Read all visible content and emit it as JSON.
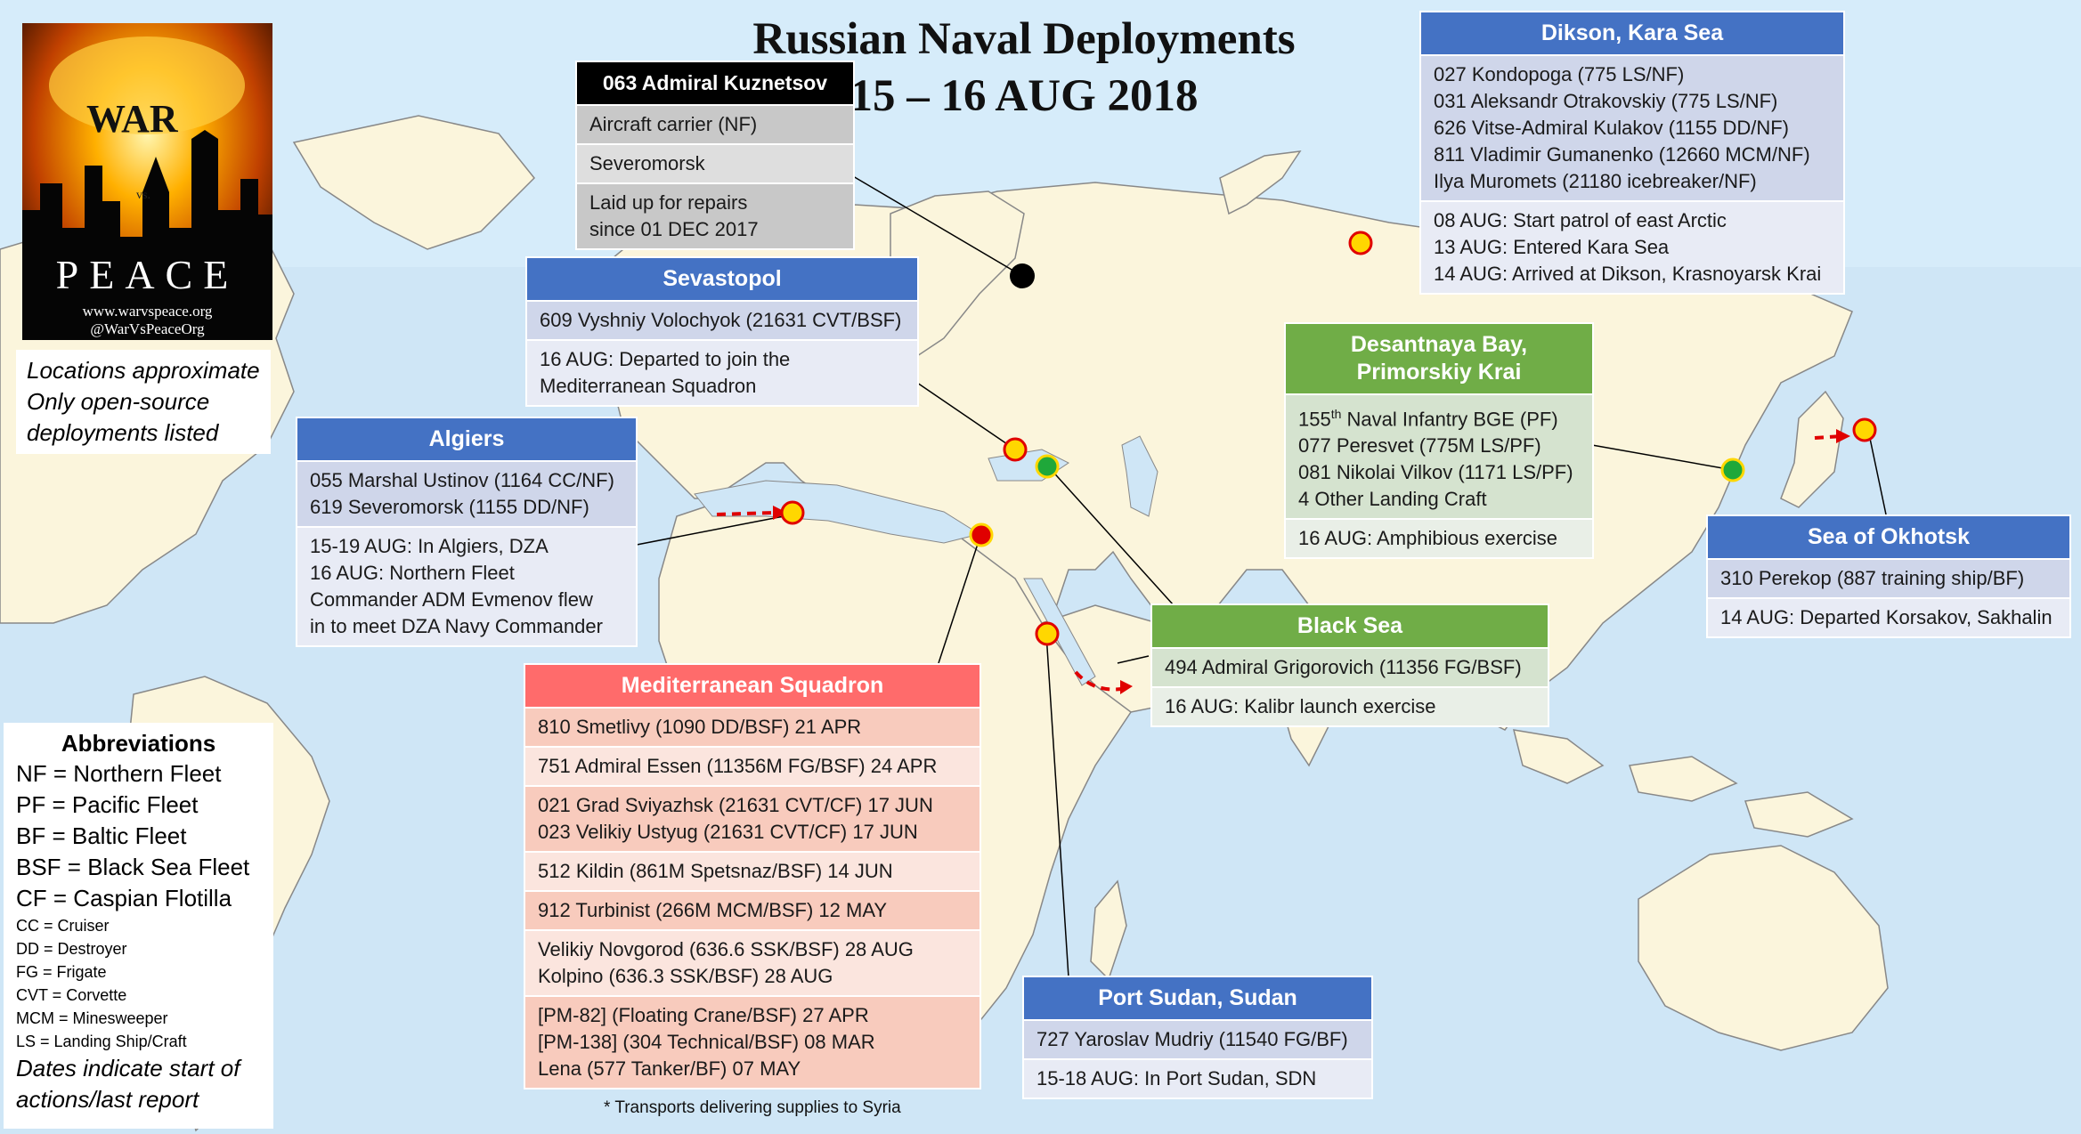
{
  "title": {
    "line1": "Russian Naval Deployments",
    "line2": "15 – 16 AUG 2018"
  },
  "logo": {
    "word_top": "WAR",
    "word_mid": "vs.",
    "word_bottom": "PEACE",
    "site": "www.warvspeace.org",
    "handle": "@WarVsPeaceOrg"
  },
  "notes": [
    "Locations approximate",
    "Only open-source",
    "deployments listed"
  ],
  "boxes": {
    "kuznetsov": {
      "header": "063 Admiral Kuznetsov",
      "rows": [
        "Aircraft carrier (NF)",
        "Severomorsk",
        "Laid up for repairs",
        "since 01 DEC 2017"
      ]
    },
    "sevastopol": {
      "header": "Sevastopol",
      "ships": [
        "609 Vyshniy Volochyok (21631 CVT/BSF)"
      ],
      "events": [
        "16 AUG: Departed to join the",
        "Mediterranean Squadron"
      ]
    },
    "algiers": {
      "header": "Algiers",
      "ships": [
        "055 Marshal Ustinov (1164 CC/NF)",
        "619 Severomorsk (1155 DD/NF)"
      ],
      "events": [
        "15-19 AUG: In Algiers, DZA",
        "16 AUG: Northern Fleet",
        "Commander ADM Evmenov flew",
        "in to meet DZA Navy Commander"
      ]
    },
    "dikson": {
      "header": "Dikson, Kara Sea",
      "ships": [
        "027 Kondopoga (775 LS/NF)",
        "031 Aleksandr Otrakovskiy (775 LS/NF)",
        "626 Vitse-Admiral Kulakov (1155 DD/NF)",
        "811 Vladimir Gumanenko (12660 MCM/NF)",
        "Ilya Muromets (21180 icebreaker/NF)"
      ],
      "events": [
        "08 AUG: Start patrol of east Arctic",
        "13 AUG: Entered Kara Sea",
        "14 AUG: Arrived at Dikson, Krasnoyarsk Krai"
      ]
    },
    "desantnaya": {
      "header1": "Desantnaya Bay,",
      "header2": "Primorskiy Krai",
      "ship0_pre": "155",
      "ship0_sup": "th",
      "ship0_post": " Naval Infantry BGE (PF)",
      "ships": [
        "077 Peresvet (775M LS/PF)",
        "081 Nikolai Vilkov (1171 LS/PF)",
        "4 Other Landing Craft"
      ],
      "events": [
        "16 AUG: Amphibious exercise"
      ]
    },
    "okhotsk": {
      "header": "Sea of Okhotsk",
      "ships": [
        "310 Perekop (887 training ship/BF)"
      ],
      "events": [
        "14 AUG: Departed Korsakov, Sakhalin"
      ]
    },
    "blacksea": {
      "header": "Black Sea",
      "ships": [
        "494 Admiral Grigorovich (11356 FG/BSF)"
      ],
      "events": [
        "16 AUG: Kalibr launch exercise"
      ]
    },
    "med": {
      "header": "Mediterranean Squadron",
      "groups": [
        [
          "810 Smetlivy (1090 DD/BSF) 21 APR"
        ],
        [
          "751 Admiral Essen (11356M FG/BSF) 24 APR"
        ],
        [
          "021 Grad Sviyazhsk (21631 CVT/CF) 17 JUN",
          "023 Velikiy Ustyug (21631 CVT/CF) 17 JUN"
        ],
        [
          "512 Kildin (861M Spetsnaz/BSF) 14 JUN"
        ],
        [
          "912 Turbinist (266M MCM/BSF) 12 MAY"
        ],
        [
          "Velikiy Novgorod (636.6 SSK/BSF) 28 AUG",
          "Kolpino (636.3 SSK/BSF) 28 AUG"
        ],
        [
          "[PM-82] (Floating Crane/BSF) 27 APR",
          "[PM-138] (304 Technical/BSF) 08 MAR",
          "Lena (577 Tanker/BF) 07 MAY"
        ]
      ]
    },
    "portsudan": {
      "header": "Port Sudan, Sudan",
      "ships": [
        "727 Yaroslav Mudriy (11540 FG/BF)"
      ],
      "events": [
        "15-18 AUG: In Port Sudan, SDN"
      ]
    }
  },
  "abbreviations": {
    "heading": "Abbreviations",
    "fleets": [
      "NF = Northern Fleet",
      "PF = Pacific Fleet",
      "BF = Baltic Fleet",
      "BSF = Black Sea Fleet",
      "CF = Caspian Flotilla"
    ],
    "types": [
      "CC = Cruiser",
      "DD = Destroyer",
      "FG = Frigate",
      "CVT = Corvette",
      "MCM = Minesweeper",
      "LS = Landing Ship/Craft"
    ],
    "note": [
      "Dates indicate start of",
      "actions/last report"
    ]
  },
  "footnote": "* Transports delivering supplies to Syria",
  "colors": {
    "blue": "#4472c4",
    "green": "#70ad47",
    "red": "#ff6b6b",
    "black": "#000000",
    "marker_yellow": "#ffd700",
    "marker_red": "#e00000",
    "marker_green": "#1fa83a",
    "ocean": "#cfe6f6",
    "land": "#fbf5dc"
  }
}
